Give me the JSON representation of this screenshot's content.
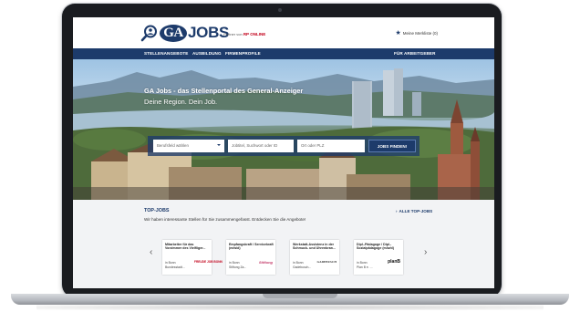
{
  "header": {
    "logo_ga": "GA",
    "logo_jobs": "JOBS",
    "partner_prefix": "Partner von",
    "partner_brand": "RP ONLINE",
    "watchlist_label": "Meine Merkliste (0)"
  },
  "nav": {
    "items": [
      "STELLENANGEBOTE",
      "AUSBILDUNG",
      "FIRMENPROFILE"
    ],
    "employer_link": "FÜR ARBEITGEBER"
  },
  "hero": {
    "title": "GA Jobs - das Stellenportal des General-Anzeiger",
    "subtitle": "Deine Region. Dein Job."
  },
  "search": {
    "category_placeholder": "Berufsfeld wählen",
    "keyword_placeholder": "Jobtitel, Suchwort oder ID",
    "location_placeholder": "Ort oder PLZ",
    "button_label": "JOBS FINDEN!"
  },
  "top_jobs": {
    "title": "TOP-JOBS",
    "subtitle": "Wir haben interessante Stellen für Sie zusammengefasst. Entdecken Sie die Angebote!",
    "all_link": "ALLE TOP-JOBS",
    "cards": [
      {
        "title": "Mitarbeiter für das Vorzimmer des Vielfliger...",
        "location": "in Bonn",
        "employer": "Bundesstadt...",
        "logo": "FREUDE JOB BONN"
      },
      {
        "title": "Empfangskraft / Servicekraft (m/w/d)",
        "location": "in Bonn",
        "employer": "Stiftung Za...",
        "logo": "Stiftung"
      },
      {
        "title": "Werkstatt-Assistenz in der Schmuck- und Uhrenbran...",
        "location": "in Bonn",
        "employer": "Gadebusch...",
        "logo": "GADEBUSCH"
      },
      {
        "title": "Dipl.-Pädagoge / Dipl.-Sozialpädagoge (m/w/d)",
        "location": "in Bonn",
        "employer": "Plan B e. ...",
        "logo": "planB"
      }
    ]
  },
  "colors": {
    "brand_navy": "#1d3b6b",
    "partner_red": "#c2001a"
  }
}
